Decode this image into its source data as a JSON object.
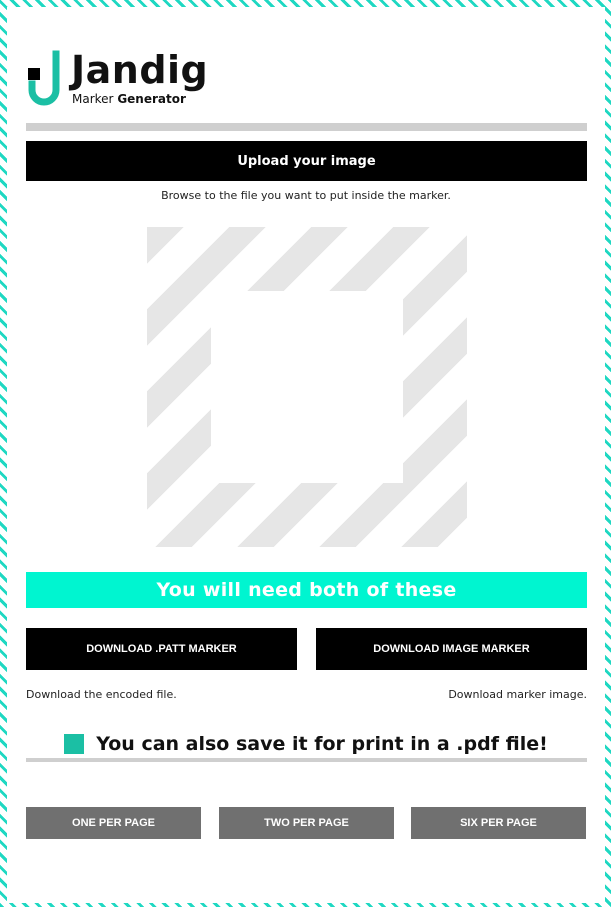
{
  "brand": {
    "name": "Jandig",
    "subtitle_prefix": "Marker",
    "subtitle_bold": "Generator",
    "accent_color": "#1bbfa4"
  },
  "upload": {
    "button_label": "Upload your image",
    "hint": "Browse to the file you want to put inside the marker."
  },
  "marker_preview": {
    "icon": "striped-marker-frame"
  },
  "downloads": {
    "banner": "You will need both of these",
    "patt_button": "DOWNLOAD .PATT MARKER",
    "image_button": "DOWNLOAD IMAGE MARKER",
    "patt_note": "Download the encoded file.",
    "image_note": "Download marker image."
  },
  "print": {
    "heading": "You can also save it for print in a .pdf file!",
    "options": [
      "ONE PER PAGE",
      "TWO PER PAGE",
      "SIX PER PAGE"
    ]
  }
}
